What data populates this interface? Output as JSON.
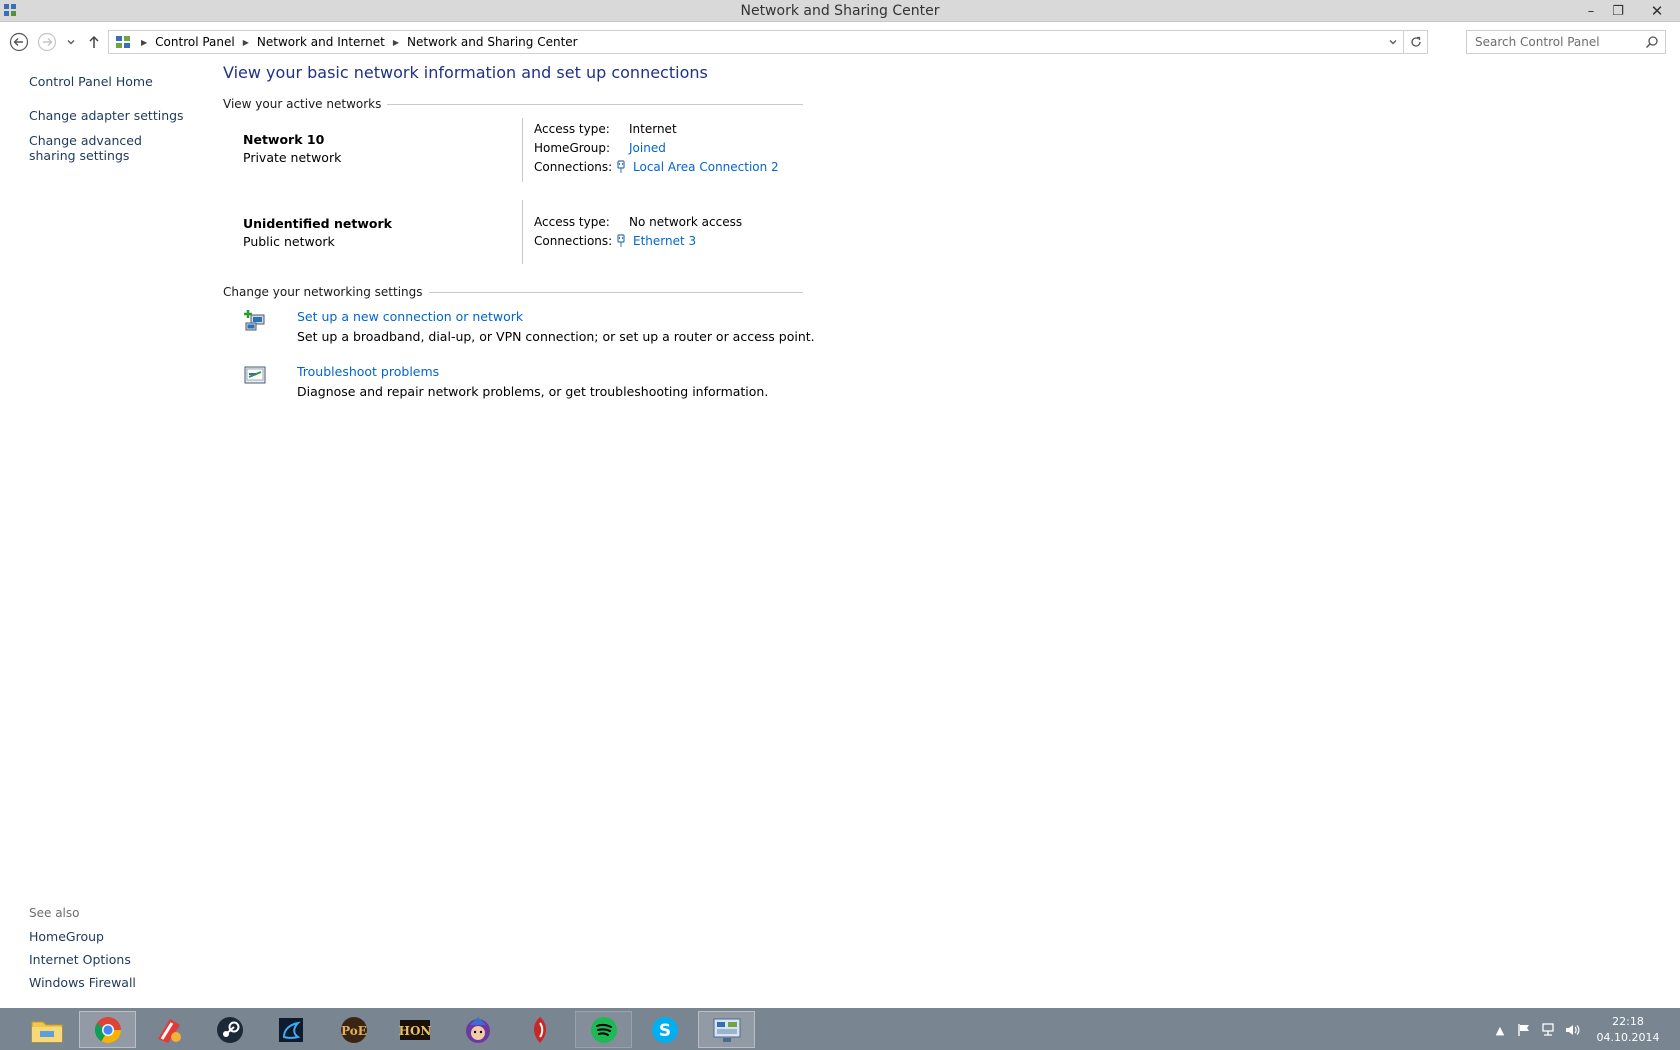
{
  "window": {
    "title": "Network and Sharing Center",
    "minimize": "–",
    "maximize": "❐",
    "close": "✕"
  },
  "address": {
    "crumbs": [
      "Control Panel",
      "Network and Internet",
      "Network and Sharing Center"
    ]
  },
  "search": {
    "placeholder": "Search Control Panel"
  },
  "left_pane": {
    "links": [
      "Control Panel Home",
      "Change adapter settings",
      "Change advanced sharing settings"
    ],
    "see_also_label": "See also",
    "see_also_links": [
      "HomeGroup",
      "Internet Options",
      "Windows Firewall"
    ]
  },
  "main": {
    "title": "View your basic network information and set up connections",
    "active_networks_header": "View your active networks",
    "networks": [
      {
        "name": "Network  10",
        "category": "Private network",
        "access_label": "Access type:",
        "access_value": "Internet",
        "homegroup_label": "HomeGroup:",
        "homegroup_value": "Joined",
        "connections_label": "Connections:",
        "connection_value": "Local Area Connection 2"
      },
      {
        "name": "Unidentified network",
        "category": "Public network",
        "access_label": "Access type:",
        "access_value": "No network access",
        "connections_label": "Connections:",
        "connection_value": "Ethernet 3"
      }
    ],
    "settings_header": "Change your networking settings",
    "tasks": [
      {
        "link": "Set up a new connection or network",
        "desc": "Set up a broadband, dial-up, or VPN connection; or set up a router or access point."
      },
      {
        "link": "Troubleshoot problems",
        "desc": "Diagnose and repair network problems, or get troubleshooting information."
      }
    ]
  },
  "taskbar": {
    "apps": [
      "file-explorer-icon",
      "chrome-icon",
      "ccleaner-icon",
      "steam-icon",
      "battlenet-icon",
      "path-of-exile-icon",
      "heroes-of-newerth-icon",
      "hearthstone-icon",
      "game-app-icon",
      "spotify-icon",
      "skype-icon",
      "control-panel-icon"
    ],
    "clock_time": "22:18",
    "clock_date": "04.10.2014"
  },
  "colors": {
    "link": "#0066cc",
    "left_link": "#1e395b",
    "title": "#1e3287",
    "taskbar": "#7a8592"
  }
}
